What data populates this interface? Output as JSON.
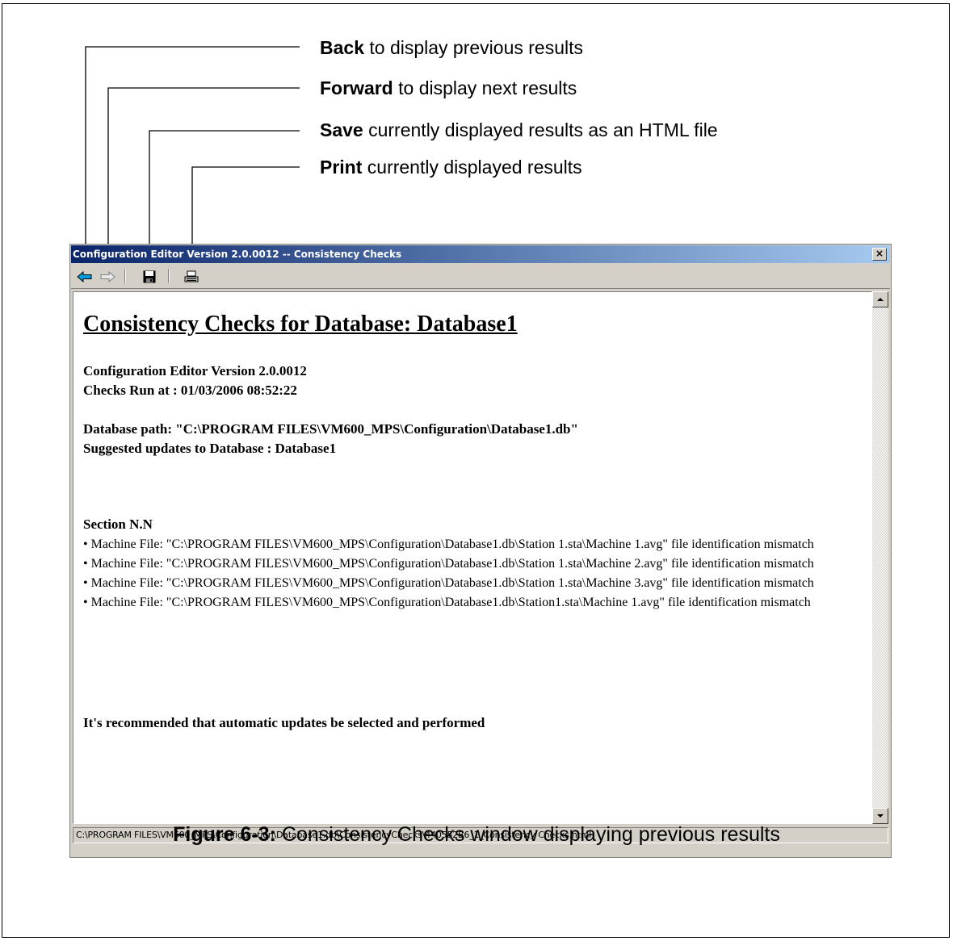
{
  "callouts": [
    {
      "bold": "Back",
      "rest": " to display previous results"
    },
    {
      "bold": "Forward",
      "rest": " to display next results"
    },
    {
      "bold": "Save",
      "rest": " currently displayed results as an HTML file"
    },
    {
      "bold": "Print",
      "rest": " currently displayed results"
    }
  ],
  "window": {
    "title": "Configuration Editor Version 2.0.0012 -- Consistency Checks",
    "close_label": "×",
    "status_path": "C:\\PROGRAM FILES\\VM600_MPS\\Configuration\\Database1.db\\ConsistencyChecks\\440552B6_1_Consistency Checks.html"
  },
  "report": {
    "title": "Consistency Checks for Database: Database1",
    "version_line": "Configuration Editor Version 2.0.0012",
    "run_line": "Checks Run at : 01/03/2006 08:52:22",
    "db_path_line": "Database path: \"C:\\PROGRAM FILES\\VM600_MPS\\Configuration\\Database1.db\"",
    "suggested_line": "Suggested updates to Database : Database1",
    "section": "Section N.N",
    "bullets": [
      "• Machine File: \"C:\\PROGRAM FILES\\VM600_MPS\\Configuration\\Database1.db\\Station 1.sta\\Machine 1.avg\" file identification mismatch",
      "• Machine File: \"C:\\PROGRAM FILES\\VM600_MPS\\Configuration\\Database1.db\\Station 1.sta\\Machine 2.avg\" file identification mismatch",
      "• Machine File: \"C:\\PROGRAM FILES\\VM600_MPS\\Configuration\\Database1.db\\Station 1.sta\\Machine 3.avg\" file identification mismatch",
      "• Machine File: \"C:\\PROGRAM FILES\\VM600_MPS\\Configuration\\Database1.db\\Station1.sta\\Machine 1.avg\" file identification mismatch"
    ],
    "recommendation": "It's recommended that automatic updates be selected and performed"
  },
  "caption": {
    "label": "Figure 6-3:",
    "text": " Consistency Checks window displaying previous results"
  },
  "colors": {
    "back_arrow": "#00a0e0",
    "titlebar_start": "#0a246a",
    "titlebar_end": "#a6caf0",
    "window_face": "#d4d0c8"
  }
}
